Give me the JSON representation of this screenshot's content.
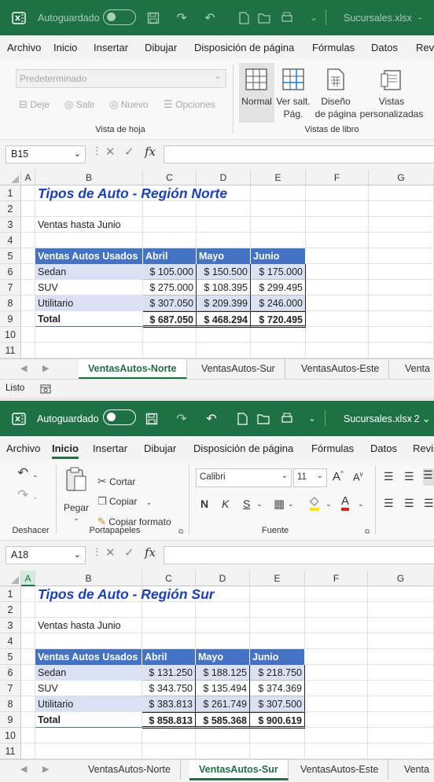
{
  "windows": [
    {
      "title": {
        "autosave": "Autoguardado",
        "filename": "Sucursales.xlsx",
        "suffix": "-"
      },
      "menu": [
        "Archivo",
        "Inicio",
        "Insertar",
        "Dibujar",
        "Disposición de página",
        "Fórmulas",
        "Datos",
        "Revi"
      ],
      "active_menu": -1,
      "ribbon": {
        "view_select": "Predeterminado",
        "sheet_view_buttons": [
          "Deje",
          "Salir",
          "Nuevo",
          "Opciones"
        ],
        "group1_label": "Vista de hoja",
        "workbook_views": [
          {
            "line1": "Normal",
            "line2": ""
          },
          {
            "line1": "Ver salt.",
            "line2": "Pág."
          },
          {
            "line1": "Diseño",
            "line2": "de página"
          },
          {
            "line1": "Vistas",
            "line2": "personalizadas"
          }
        ],
        "group2_label": "Vistas de libro"
      },
      "namebox": "B15",
      "fx": "fx",
      "columns": [
        "A",
        "B",
        "C",
        "D",
        "E",
        "F",
        "G"
      ],
      "selected_column": -1,
      "rows": [
        "1",
        "2",
        "3",
        "4",
        "5",
        "6",
        "7",
        "8",
        "9",
        "10",
        "11"
      ],
      "sheet": {
        "title": "Tipos de Auto - Región Norte",
        "subtitle": "Ventas hasta Junio",
        "headers": [
          "Ventas Autos Usados",
          "Abril",
          "Mayo",
          "Junio"
        ],
        "data": [
          [
            "Sedan",
            "$ 105.000",
            "$ 150.500",
            "$ 175.000"
          ],
          [
            "SUV",
            "$ 275.000",
            "$ 108.395",
            "$ 299.495"
          ],
          [
            "Utilitario",
            "$ 307.050",
            "$ 209.399",
            "$ 246.000"
          ]
        ],
        "total": [
          "Total",
          "$ 687.050",
          "$ 468.294",
          "$ 720.495"
        ]
      },
      "tabs": [
        "VentasAutos-Norte",
        "VentasAutos-Sur",
        "VentasAutos-Este",
        "Venta"
      ],
      "active_tab": 0,
      "status": "Listo"
    },
    {
      "title": {
        "autosave": "Autoguardado",
        "filename": "Sucursales.xlsx",
        "suffix": "- 2 ⌄"
      },
      "menu": [
        "Archivo",
        "Inicio",
        "Insertar",
        "Dibujar",
        "Disposición de página",
        "Fórmulas",
        "Datos",
        "Revis"
      ],
      "active_menu": 1,
      "ribbon": {
        "undo_label": "Deshacer",
        "paste_label": "Pegar",
        "clipboard_buttons": [
          "Cortar",
          "Copiar",
          "Copiar formato"
        ],
        "clipboard_label": "Portapapeles",
        "font_name": "Calibri",
        "font_size": "11",
        "font_label": "Fuente",
        "format_buttons": [
          "N",
          "K",
          "S"
        ]
      },
      "namebox": "A18",
      "fx": "fx",
      "columns": [
        "A",
        "B",
        "C",
        "D",
        "E",
        "F",
        "G"
      ],
      "selected_column": 0,
      "rows": [
        "1",
        "2",
        "3",
        "4",
        "5",
        "6",
        "7",
        "8",
        "9",
        "10",
        "11"
      ],
      "sheet": {
        "title": "Tipos de Auto - Región Sur",
        "subtitle": "Ventas hasta Junio",
        "headers": [
          "Ventas Autos Usados",
          "Abril",
          "Mayo",
          "Junio"
        ],
        "data": [
          [
            "Sedan",
            "$ 131.250",
            "$ 188.125",
            "$ 218.750"
          ],
          [
            "SUV",
            "$ 343.750",
            "$ 135.494",
            "$ 374.369"
          ],
          [
            "Utilitario",
            "$ 383.813",
            "$ 261.749",
            "$ 307.500"
          ]
        ],
        "total": [
          "Total",
          "$ 858.813",
          "$ 585.368",
          "$ 900.619"
        ]
      },
      "tabs": [
        "VentasAutos-Norte",
        "VentasAutos-Sur",
        "VentasAutos-Este",
        "Venta"
      ],
      "active_tab": 1
    }
  ],
  "colors": {
    "excel_green": "#1e7145",
    "header_blue": "#4472c4",
    "band_blue": "#d9e1f2",
    "title_blue": "#1a3fbf"
  }
}
